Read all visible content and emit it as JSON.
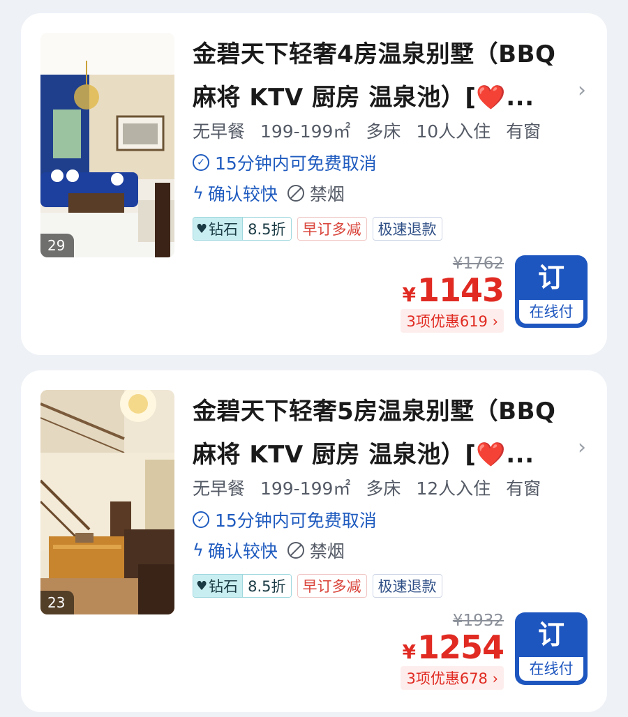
{
  "listings": [
    {
      "title_line1": "金碧天下轻奢4房温泉别墅（BBQ",
      "title_line2_text": "麻将 KTV 厨房 温泉池）[",
      "title_heart": "❤️",
      "title_ellipsis": "...",
      "photo_count": "29",
      "info": {
        "breakfast": "无早餐",
        "area": "199-199㎡",
        "beds": "多床",
        "occupancy": "10人入住",
        "window": "有窗"
      },
      "cancel_text": "15分钟内可免费取消",
      "confirm_text": "确认较快",
      "smoking_text": "禁烟",
      "tags": {
        "diamond": "钻石",
        "discount": "8.5折",
        "early": "早订多减",
        "refund": "极速退款"
      },
      "original_price": "¥1762",
      "currency": "¥",
      "price": "1143",
      "promo": "3项优惠619 ›",
      "book_label": "订",
      "pay_label": "在线付"
    },
    {
      "title_line1": "金碧天下轻奢5房温泉别墅（BBQ",
      "title_line2_text": "麻将 KTV 厨房 温泉池）[",
      "title_heart": "❤️",
      "title_ellipsis": "...",
      "photo_count": "23",
      "info": {
        "breakfast": "无早餐",
        "area": "199-199㎡",
        "beds": "多床",
        "occupancy": "12人入住",
        "window": "有窗"
      },
      "cancel_text": "15分钟内可免费取消",
      "confirm_text": "确认较快",
      "smoking_text": "禁烟",
      "tags": {
        "diamond": "钻石",
        "discount": "8.5折",
        "early": "早订多减",
        "refund": "极速退款"
      },
      "original_price": "¥1932",
      "currency": "¥",
      "price": "1254",
      "promo": "3项优惠678 ›",
      "book_label": "订",
      "pay_label": "在线付"
    }
  ],
  "colors": {
    "accent": "#1e56bf",
    "price": "#e02a22",
    "background": "#eef1f6"
  }
}
